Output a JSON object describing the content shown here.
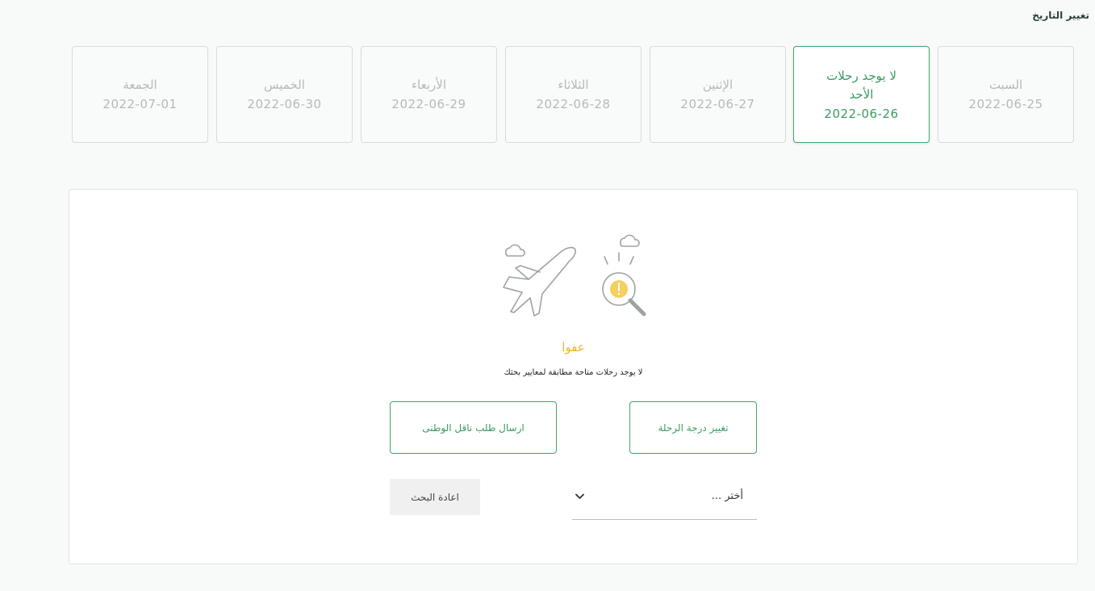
{
  "header": {
    "title": "تغيير التاريخ"
  },
  "days": [
    {
      "name": "السبت",
      "date": "2022-06-25",
      "note": "",
      "active": false
    },
    {
      "name": "الأحد",
      "date": "2022-06-26",
      "note": "لا يوجد رحلات",
      "active": true
    },
    {
      "name": "الإثنين",
      "date": "2022-06-27",
      "note": "",
      "active": false
    },
    {
      "name": "الثلاثاء",
      "date": "2022-06-28",
      "note": "",
      "active": false
    },
    {
      "name": "الأربعاء",
      "date": "2022-06-29",
      "note": "",
      "active": false
    },
    {
      "name": "الخميس",
      "date": "2022-06-30",
      "note": "",
      "active": false
    },
    {
      "name": "الجمعة",
      "date": "2022-07-01",
      "note": "",
      "active": false
    }
  ],
  "result": {
    "illustration_icon": "plane-search-warning-icon",
    "title": "عفوا",
    "message": "لا يوجد رحلات متاحة مطابقة لمعايير بحثك",
    "change_class_label": "تغيير درجة الرحلة",
    "national_carrier_label": "ارسال طلب ناقل الوطنى",
    "select_placeholder": "أختر ...",
    "reset_label": "اعادة البحث"
  },
  "colors": {
    "accent": "#43a56a",
    "warning": "#f2b430",
    "muted_text": "#b5bab9"
  }
}
